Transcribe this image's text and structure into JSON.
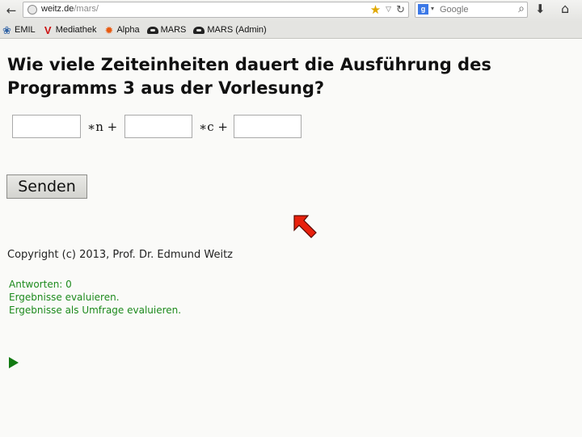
{
  "browser": {
    "url_domain": "weitz.de",
    "url_path": "/mars/",
    "search_placeholder": "Google",
    "search_engine_letter": "g",
    "icons": {
      "back": "back-arrow-icon",
      "site": "globe-icon",
      "bookmark": "star-icon",
      "dropmarker": "dropdown-icon",
      "reload": "reload-icon",
      "search_go": "magnifier-icon",
      "downloads": "download-arrow-icon",
      "home": "home-icon"
    }
  },
  "bookmarks": [
    {
      "label": "EMIL",
      "icon": "emil-icon"
    },
    {
      "label": "Mediathek",
      "icon": "mediathek-icon"
    },
    {
      "label": "Alpha",
      "icon": "alpha-icon"
    },
    {
      "label": "MARS",
      "icon": "mars-icon"
    },
    {
      "label": "MARS (Admin)",
      "icon": "mars-icon"
    }
  ],
  "question": {
    "title": "Wie viele Zeiteinheiten dauert die Ausführung des Programms 3 aus der Vorlesung?"
  },
  "formula": {
    "field1_value": "",
    "term1": "∗n +",
    "field2_value": "",
    "term2": "∗c +",
    "field3_value": ""
  },
  "form": {
    "submit_label": "Senden"
  },
  "footer": {
    "copyright": "Copyright (c) 2013, Prof. Dr. Edmund Weitz",
    "answers": "Antworten: 0",
    "evaluate_link": "Ergebnisse evaluieren.",
    "survey_link": "Ergebnisse als Umfrage evaluieren."
  },
  "colors": {
    "link_green": "#1d8a1d",
    "cursor_red": "#e8200c"
  }
}
